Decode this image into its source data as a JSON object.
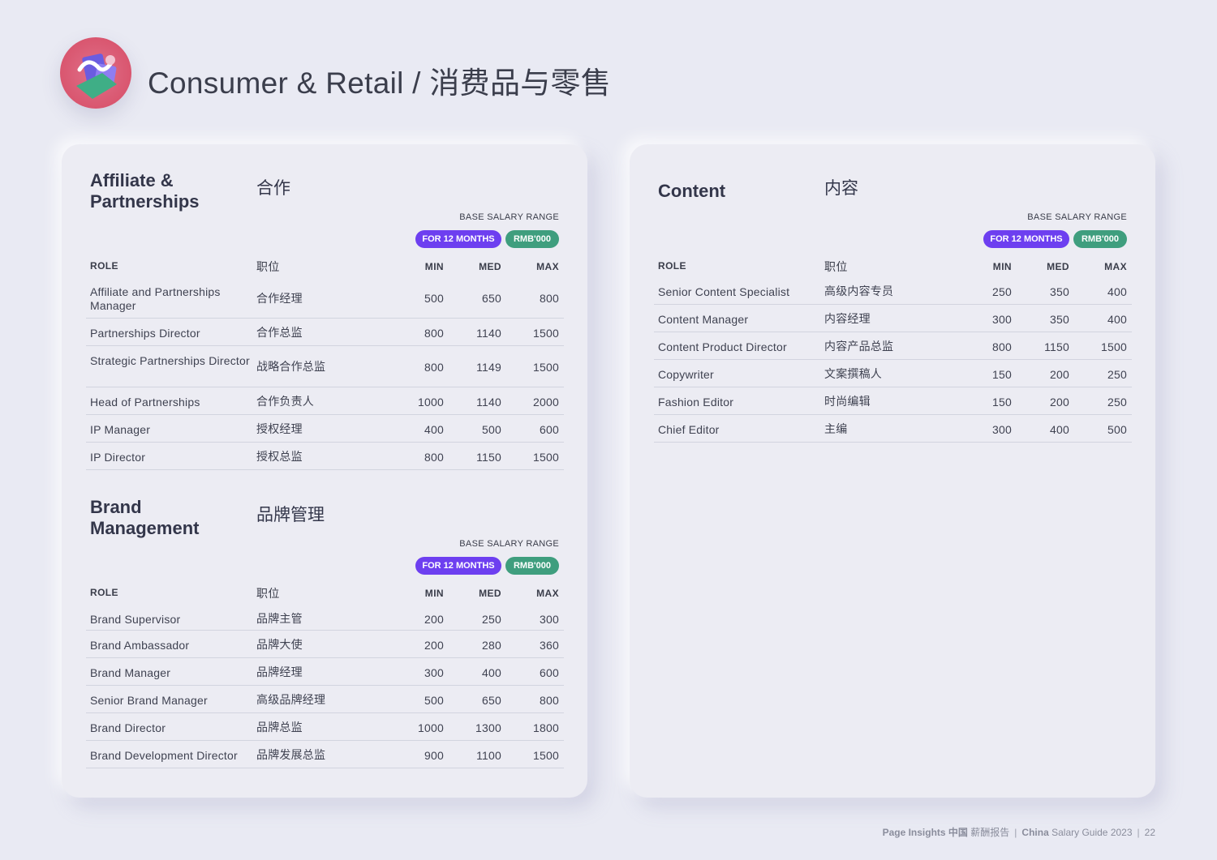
{
  "page": {
    "title": "Consumer & Retail / 消费品与零售",
    "logo_icon": "shopping-illustration-icon"
  },
  "salary_labels": {
    "range": "BASE SALARY RANGE",
    "months": "FOR 12 MONTHS",
    "currency": "RMB'000"
  },
  "headers": {
    "role": "ROLE",
    "role_cn": "职位",
    "min": "MIN",
    "med": "MED",
    "max": "MAX"
  },
  "sections": {
    "affiliate": {
      "title_en": "Affiliate & Partnerships",
      "title_cn": "合作",
      "rows": [
        {
          "role": "Affiliate and Partnerships Manager",
          "cn": "合作经理",
          "min": "500",
          "med": "650",
          "max": "800"
        },
        {
          "role": "Partnerships Director",
          "cn": "合作总监",
          "min": "800",
          "med": "1140",
          "max": "1500"
        },
        {
          "role": "Strategic Partnerships Director",
          "cn": "战略合作总监",
          "min": "800",
          "med": "1149",
          "max": "1500"
        },
        {
          "role": "Head of Partnerships",
          "cn": "合作负责人",
          "min": "1000",
          "med": "1140",
          "max": "2000"
        },
        {
          "role": "IP Manager",
          "cn": "授权经理",
          "min": "400",
          "med": "500",
          "max": "600"
        },
        {
          "role": "IP Director",
          "cn": "授权总监",
          "min": "800",
          "med": "1150",
          "max": "1500"
        }
      ]
    },
    "brand": {
      "title_en": "Brand Management",
      "title_cn": "品牌管理",
      "rows": [
        {
          "role": "Brand Supervisor",
          "cn": "品牌主管",
          "min": "200",
          "med": "250",
          "max": "300"
        },
        {
          "role": "Brand Ambassador",
          "cn": "品牌大使",
          "min": "200",
          "med": "280",
          "max": "360"
        },
        {
          "role": "Brand Manager",
          "cn": "品牌经理",
          "min": "300",
          "med": "400",
          "max": "600"
        },
        {
          "role": "Senior Brand Manager",
          "cn": "高级品牌经理",
          "min": "500",
          "med": "650",
          "max": "800"
        },
        {
          "role": "Brand Director",
          "cn": "品牌总监",
          "min": "1000",
          "med": "1300",
          "max": "1800"
        },
        {
          "role": "Brand Development Director",
          "cn": "品牌发展总监",
          "min": "900",
          "med": "1100",
          "max": "1500"
        }
      ]
    },
    "content": {
      "title_en": "Content",
      "title_cn": "内容",
      "rows": [
        {
          "role": "Senior Content Specialist",
          "cn": "高级内容专员",
          "min": "250",
          "med": "350",
          "max": "400"
        },
        {
          "role": "Content Manager",
          "cn": "内容经理",
          "min": "300",
          "med": "350",
          "max": "400"
        },
        {
          "role": "Content Product Director",
          "cn": "内容产品总监",
          "min": "800",
          "med": "1150",
          "max": "1500"
        },
        {
          "role": "Copywriter",
          "cn": "文案撰稿人",
          "min": "150",
          "med": "200",
          "max": "250"
        },
        {
          "role": "Fashion Editor",
          "cn": "时尚编辑",
          "min": "150",
          "med": "200",
          "max": "250"
        },
        {
          "role": "Chief Editor",
          "cn": "主编",
          "min": "300",
          "med": "400",
          "max": "500"
        }
      ]
    }
  },
  "footer": {
    "brand_bold": "Page Insights 中国",
    "brand_rest": "薪酬报告",
    "guide_bold": "China",
    "guide_rest": "Salary Guide 2023",
    "page_number": "22"
  }
}
